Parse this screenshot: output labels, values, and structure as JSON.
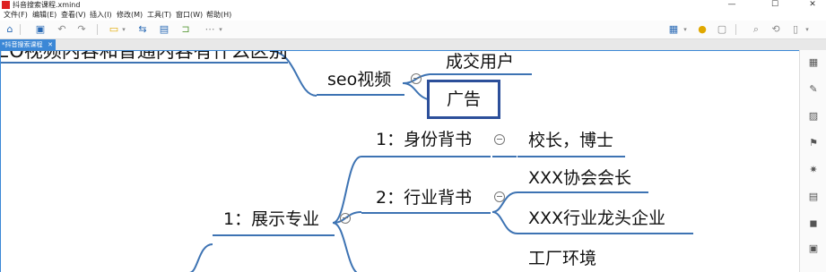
{
  "window": {
    "title": "抖音搜索课程.xmind",
    "minimize": "—",
    "maximize": "☐",
    "close": "✕"
  },
  "menu": [
    "文件(F)",
    "编辑(E)",
    "查看(V)",
    "插入(I)",
    "修改(M)",
    "工具(T)",
    "窗口(W)",
    "帮助(H)"
  ],
  "tab": {
    "label": "*抖音搜索课程",
    "close": "✕"
  },
  "mindmap": {
    "top_title": "EO视频内容和普通内容有什么区别",
    "seo_branch": "seo视频",
    "seo_child_1": "成交用户",
    "seo_child_2": "广告",
    "show_branch": "1：展示专业",
    "identity": "1：身份背书",
    "identity_child": "校长，博士",
    "industry": "2：行业背书",
    "industry_child_1": "XXX协会会长",
    "industry_child_2": "XXX行业龙头企业",
    "factory": "工厂环境"
  },
  "colors": {
    "accent": "#3b87d6",
    "line": "#3d73b3",
    "selection": "#2c4f9a"
  }
}
